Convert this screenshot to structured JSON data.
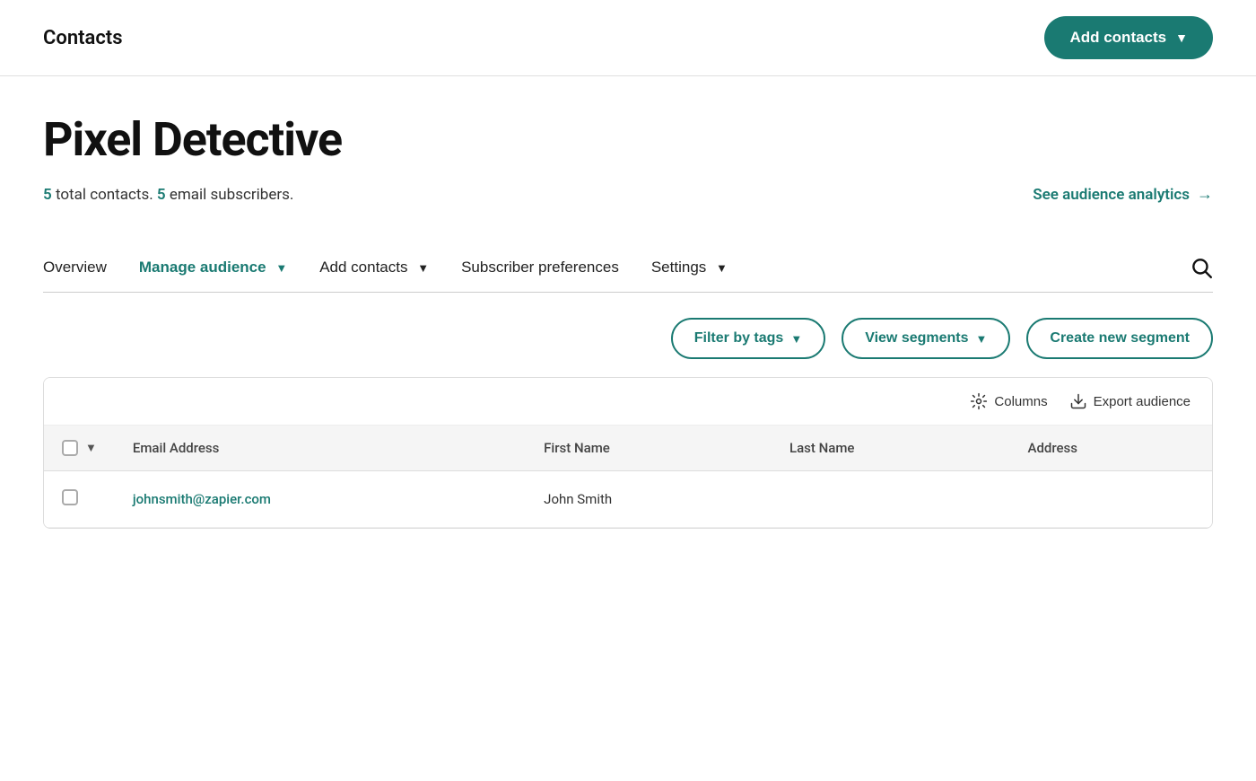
{
  "header": {
    "title": "Contacts",
    "add_contacts_label": "Add contacts",
    "add_contacts_chevron": "▼"
  },
  "audience": {
    "name": "Pixel Detective",
    "total_contacts": 5,
    "email_subscribers": 5,
    "stats_prefix": "total contacts.",
    "stats_suffix": "email subscribers.",
    "analytics_link": "See audience analytics"
  },
  "nav": {
    "tabs": [
      {
        "id": "overview",
        "label": "Overview",
        "active": false,
        "has_chevron": false
      },
      {
        "id": "manage-audience",
        "label": "Manage audience",
        "active": true,
        "has_chevron": true
      },
      {
        "id": "add-contacts",
        "label": "Add contacts",
        "active": false,
        "has_chevron": true
      },
      {
        "id": "subscriber-preferences",
        "label": "Subscriber preferences",
        "active": false,
        "has_chevron": false
      },
      {
        "id": "settings",
        "label": "Settings",
        "active": false,
        "has_chevron": true
      }
    ]
  },
  "toolbar": {
    "filter_tags_label": "Filter by tags",
    "view_segments_label": "View segments",
    "create_segment_label": "Create new segment"
  },
  "table": {
    "columns_label": "Columns",
    "export_label": "Export audience",
    "headers": [
      "Email Address",
      "First Name",
      "Last Name",
      "Address"
    ],
    "rows": [
      {
        "email": "johnsmith@zapier.com",
        "first_name": "John Smith",
        "last_name": "",
        "address": ""
      }
    ]
  },
  "colors": {
    "teal": "#1a7a72",
    "light_gray": "#f5f5f5",
    "border": "#ddd"
  }
}
